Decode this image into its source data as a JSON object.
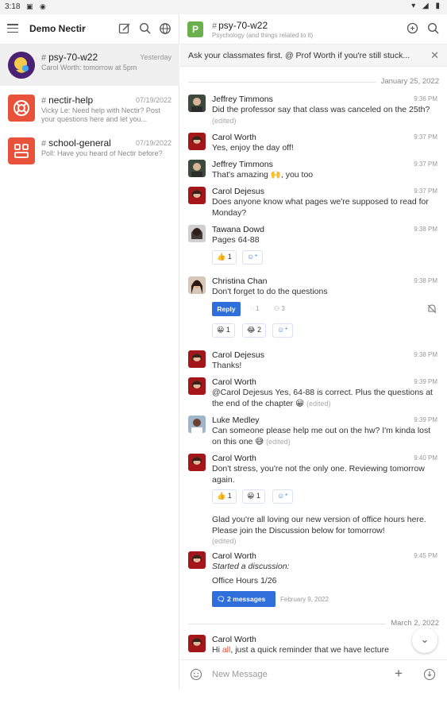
{
  "status": {
    "time": "3:18"
  },
  "sidebar": {
    "workspace": "Demo Nectir",
    "conversations": [
      {
        "name": "psy-70-w22",
        "date": "Yesterday",
        "preview": "Carol Worth: tomorrow at 5pm"
      },
      {
        "name": "nectir-help",
        "date": "07/19/2022",
        "preview": "Vicky Le: Need help with Nectir? Post your questions here and let you..."
      },
      {
        "name": "school-general",
        "date": "07/19/2022",
        "preview": "Poll: Have you heard of Nectir before?"
      }
    ]
  },
  "channel": {
    "badge": "P",
    "name": "psy-70-w22",
    "subtitle": "Psychology (and things related to it)",
    "pinned": "Ask your classmates first. @ Prof Worth if you're still stuck..."
  },
  "dates": {
    "d1": "January 25, 2022",
    "d2": "March 2, 2022"
  },
  "messages": {
    "m1": {
      "author": "Jeffrey Timmons",
      "time": "9:36 PM",
      "text": "Did the professor say that class was canceled on the 25th?",
      "edited": "(edited)"
    },
    "m2": {
      "author": "Carol Worth",
      "time": "9:37 PM",
      "text": "Yes, enjoy the day off!"
    },
    "m3": {
      "author": "Jeffrey Timmons",
      "time": "9:37 PM",
      "text": "That's amazing 🙌, you too"
    },
    "m4": {
      "author": "Carol Dejesus",
      "time": "9:37 PM",
      "text": "Does anyone know what pages we're supposed to read for Monday?"
    },
    "m5": {
      "author": "Tawana Dowd",
      "time": "9:38 PM",
      "text": "Pages 64-88",
      "reaction1": "👍 1"
    },
    "m6": {
      "author": "Christina Chan",
      "time": "9:38 PM",
      "text": "Don't forget to do the questions",
      "reply": "Reply",
      "replies": "1",
      "followers": "3",
      "reaction1": "😀 1",
      "reaction2": "😂 2"
    },
    "m7": {
      "author": "Carol Dejesus",
      "time": "9:38 PM",
      "text": "Thanks!"
    },
    "m8": {
      "author": "Carol Worth",
      "time": "9:39 PM",
      "text": "@Carol Dejesus Yes, 64-88 is correct. Plus the questions at the end of the chapter 😀",
      "edited": "(edited)"
    },
    "m9": {
      "author": "Luke Medley",
      "time": "9:39 PM",
      "text": "Can someone please help me out on the hw? I'm kinda lost on this one 😅",
      "edited": "(edited)"
    },
    "m10": {
      "author": "Carol Worth",
      "time": "9:40 PM",
      "text": "Don't stress, you're not the only one. Reviewing tomorrow again.",
      "reaction1": "👍 1",
      "reaction2": "😀 1"
    },
    "m11": {
      "text": "Glad you're all loving our new version of office hours here. Please join the Discussion below for tomorrow!",
      "edited": "(edited)"
    },
    "m12": {
      "author": "Carol Worth",
      "time": "9:45 PM",
      "started": "Started a discussion:",
      "title": "Office Hours 1/26",
      "button": "2 messages",
      "date": "February 9, 2022"
    },
    "m13": {
      "author": "Carol Worth",
      "text_pre": "Hi ",
      "mention": "all",
      "text_post": ", just a quick reminder that we have lecture"
    }
  },
  "composer": {
    "placeholder": "New Message"
  },
  "colors": {
    "accent": "#2f6fdb",
    "brand_red": "#e8523a",
    "channel_badge": "#6ab04c"
  }
}
